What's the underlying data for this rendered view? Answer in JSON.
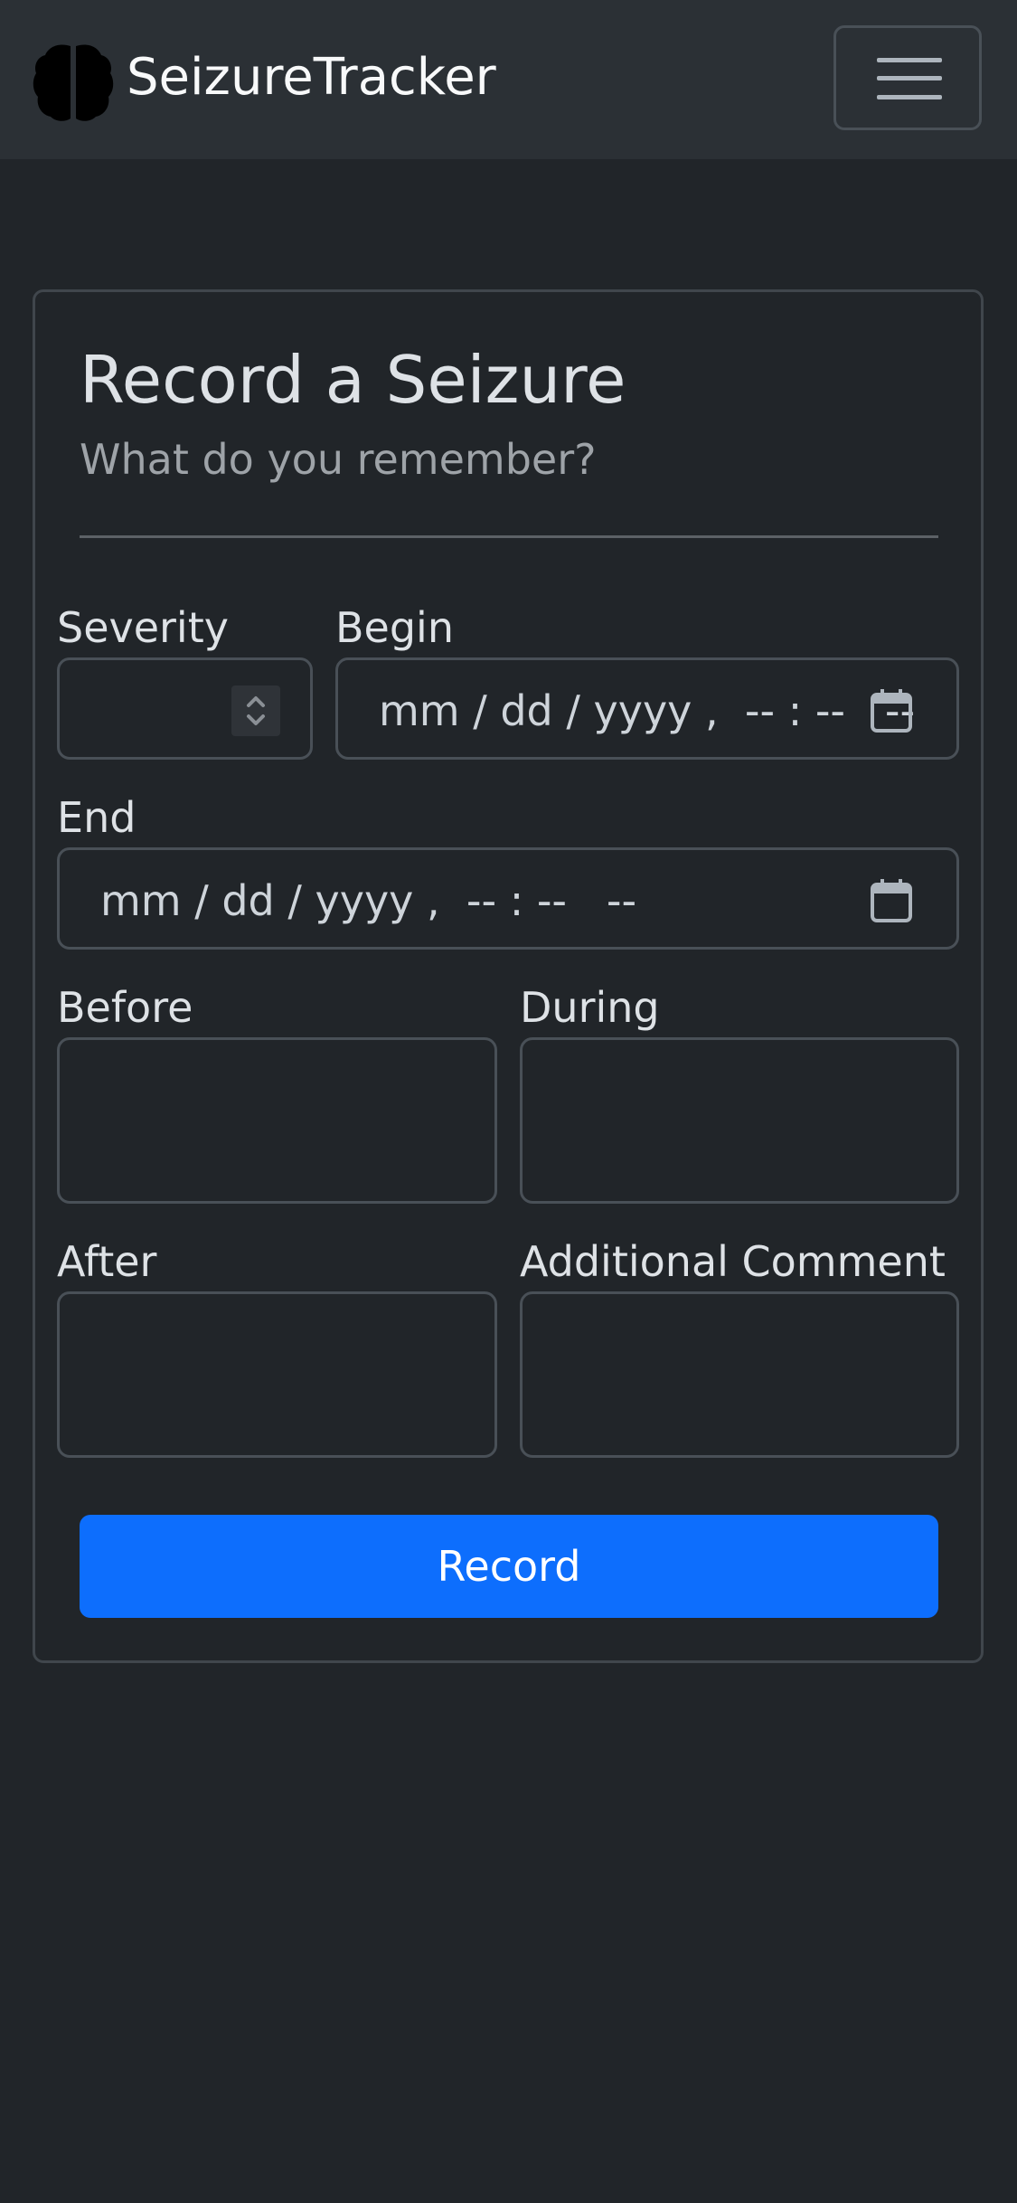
{
  "navbar": {
    "brand": "SeizureTracker",
    "logo_icon": "brain-icon",
    "toggler_icon": "hamburger-menu-icon"
  },
  "form": {
    "title": "Record a Seizure",
    "subtitle": "What do you remember?",
    "severity": {
      "label": "Severity",
      "value": ""
    },
    "begin": {
      "label": "Begin",
      "placeholder": "mm / dd / yyyy ,  -- : --   --"
    },
    "end": {
      "label": "End",
      "placeholder": "mm / dd / yyyy ,  -- : --   --"
    },
    "before": {
      "label": "Before",
      "value": ""
    },
    "during": {
      "label": "During",
      "value": ""
    },
    "after": {
      "label": "After",
      "value": ""
    },
    "comment": {
      "label": "Additional Comment",
      "value": ""
    },
    "submit_label": "Record"
  },
  "colors": {
    "background": "#212529",
    "navbar": "#2b3035",
    "accent": "#0d6efd"
  }
}
